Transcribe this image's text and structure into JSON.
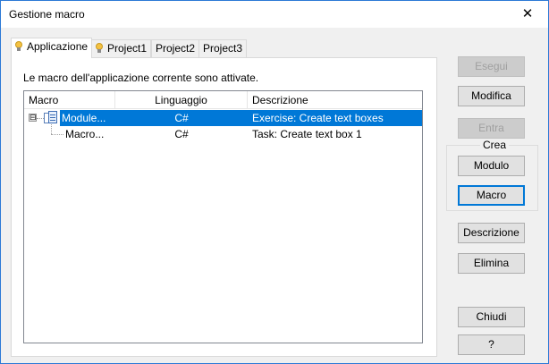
{
  "window": {
    "title": "Gestione macro",
    "close_glyph": "✕"
  },
  "tabs": [
    {
      "label": "Applicazione",
      "icon": "lightbulb-icon",
      "active": true
    },
    {
      "label": "Project1",
      "icon": "lightbulb-icon",
      "active": false
    },
    {
      "label": "Project2",
      "active": false
    },
    {
      "label": "Project3",
      "active": false
    }
  ],
  "panel": {
    "info": "Le macro dell'applicazione corrente sono attivate."
  },
  "list": {
    "columns": [
      "Macro",
      "Linguaggio",
      "Descrizione"
    ],
    "rows": [
      {
        "macro": "Module...",
        "language": "C#",
        "description": "Exercise: Create text boxes",
        "selected": true,
        "expander": "⊟",
        "icon": "module-icon"
      },
      {
        "macro": "Macro...",
        "language": "C#",
        "description": "Task: Create text box 1",
        "selected": false
      }
    ]
  },
  "buttons": {
    "esegui": "Esegui",
    "modifica": "Modifica",
    "entra": "Entra",
    "crea_group": "Crea",
    "modulo": "Modulo",
    "macro": "Macro",
    "descrizione": "Descrizione",
    "elimina": "Elimina",
    "chiudi": "Chiudi",
    "help": "?"
  },
  "colors": {
    "selection": "#0078d7",
    "focus": "#0078d7",
    "window_border": "#2b79d6"
  }
}
